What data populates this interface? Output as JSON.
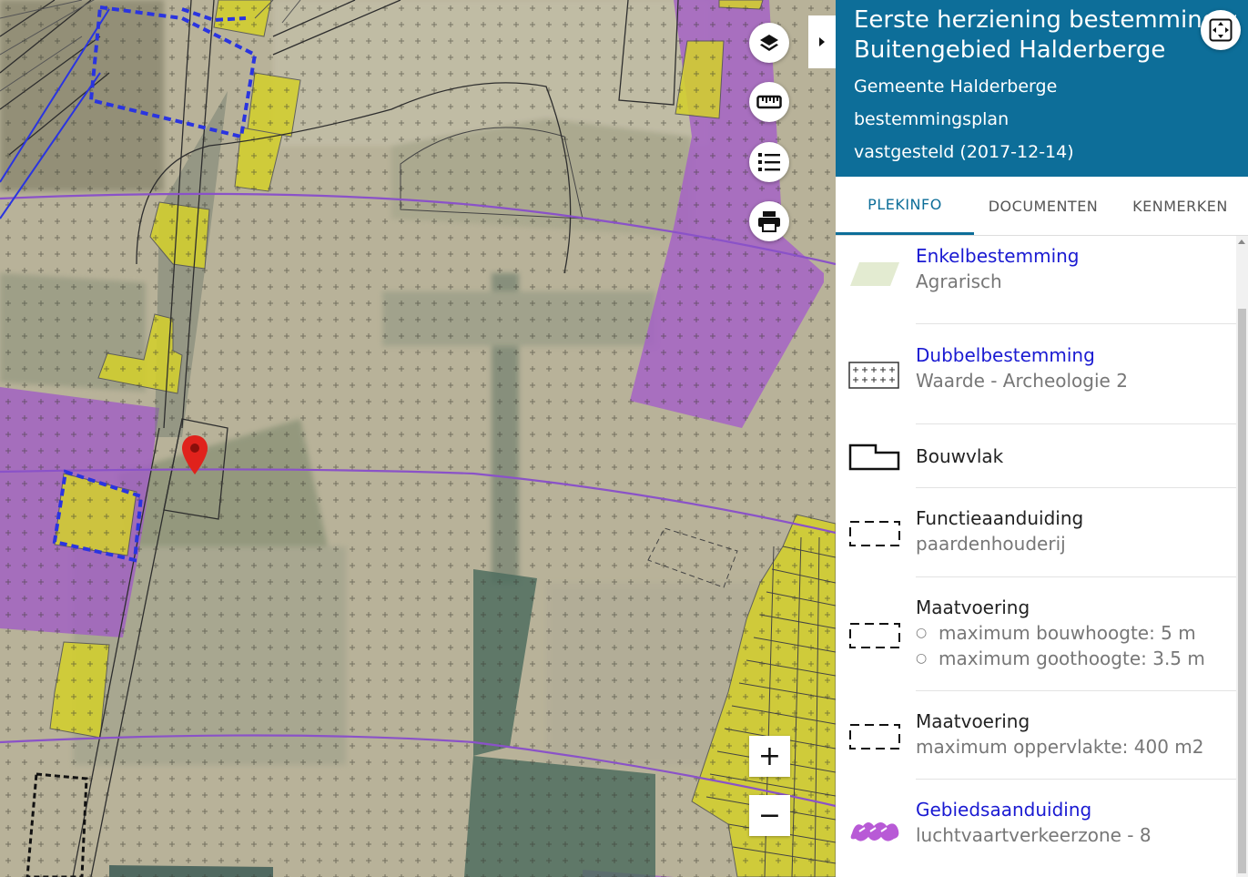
{
  "map": {
    "controls": {
      "layers_icon": "layers-icon",
      "measure_icon": "ruler-icon",
      "legend_icon": "list-icon",
      "print_icon": "printer-icon",
      "zoom_in_label": "+",
      "zoom_out_label": "−",
      "collapse_icon": "chevron-right-icon"
    },
    "marker_icon": "map-pin-icon",
    "colors": {
      "agrarisch_bg": "#b6b095",
      "purple_zone": "#a05ec4",
      "yellow_zone": "#cfcd30",
      "blue_outline": "#2a34e0",
      "route_purple": "#8a52c8",
      "marker_red": "#e0221c"
    }
  },
  "panel": {
    "title_line1": "Eerste herziening bestemmingsplan",
    "title_line2": "Buitengebied Halderberge",
    "municipality": "Gemeente Halderberge",
    "plan_type": "bestemmingsplan",
    "status": "vastgesteld (2017-12-14)",
    "expand_icon": "fullscreen-icon",
    "tabs": [
      {
        "label": "PLEKINFO",
        "active": true
      },
      {
        "label": "DOCUMENTEN",
        "active": false
      },
      {
        "label": "KENMERKEN",
        "active": false
      }
    ],
    "items": [
      {
        "title": "Enkelbestemming",
        "sub": "Agrarisch",
        "icon": "green-area-icon"
      },
      {
        "title": "Dubbelbestemming",
        "sub": "Waarde - Archeologie 2",
        "icon": "crosshatch-area-icon"
      },
      {
        "title": "Bouwvlak",
        "sub": "",
        "icon": "building-outline-icon"
      },
      {
        "title": "Functieaanduiding",
        "sub": "paardenhouderij",
        "icon": "dashed-box-icon"
      },
      {
        "title": "Maatvoering",
        "bullets": [
          "maximum bouwhoogte: 5 m",
          "maximum goothoogte: 3.5 m"
        ],
        "icon": "dashed-box-icon"
      },
      {
        "title": "Maatvoering",
        "sub": "maximum oppervlakte: 400 m2",
        "icon": "dashed-box-icon"
      },
      {
        "title": "Gebiedsaanduiding",
        "sub": "luchtvaartverkeerzone - 8",
        "icon": "purple-zone-icon"
      }
    ]
  }
}
